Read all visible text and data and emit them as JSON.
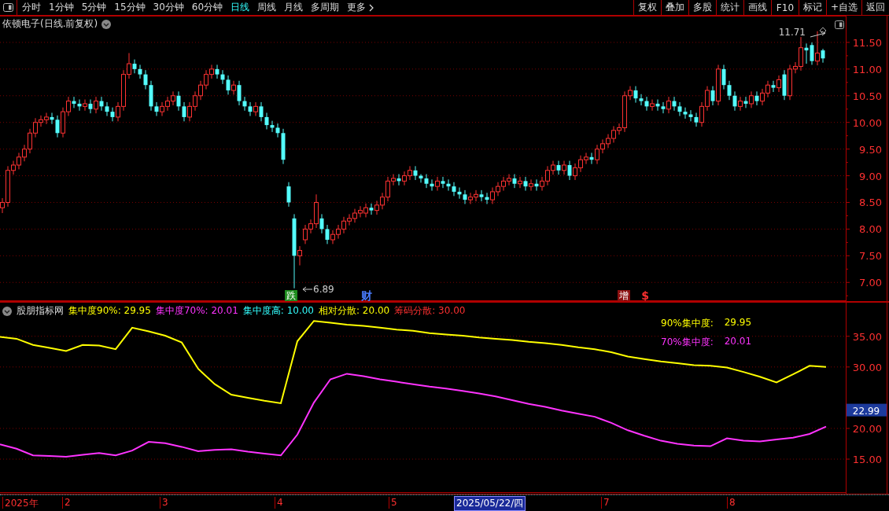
{
  "toolbar": {
    "periods": [
      {
        "label": "分时",
        "selected": false
      },
      {
        "label": "1分钟",
        "selected": false
      },
      {
        "label": "5分钟",
        "selected": false
      },
      {
        "label": "15分钟",
        "selected": false
      },
      {
        "label": "30分钟",
        "selected": false
      },
      {
        "label": "60分钟",
        "selected": false
      },
      {
        "label": "日线",
        "selected": true
      },
      {
        "label": "周线",
        "selected": false
      },
      {
        "label": "月线",
        "selected": false
      },
      {
        "label": "多周期",
        "selected": false
      },
      {
        "label": "更多",
        "selected": false
      }
    ],
    "actions": [
      "复权",
      "叠加",
      "多股",
      "统计",
      "画线",
      "F10",
      "标记",
      "+自选",
      "返回"
    ]
  },
  "price_pane": {
    "title": "依顿电子(日线.前复权)",
    "high_label": "11.71",
    "low_label": "6.89",
    "event_marks": [
      {
        "text": "跌",
        "kind": "boxed",
        "color": "#1e8c1e"
      },
      {
        "text": "财",
        "kind": "plain",
        "color": "#4a7dff"
      },
      {
        "text": "增",
        "kind": "boxed",
        "color": "#8c1010"
      },
      {
        "text": "$",
        "kind": "plain",
        "color": "#ff3030"
      }
    ],
    "chart_data": {
      "type": "candlestick",
      "grid": true,
      "ylim": [
        6.65,
        12.0
      ],
      "categories": [
        null,
        null,
        null,
        null,
        null,
        null,
        null,
        null,
        null,
        null,
        null,
        null,
        null,
        null,
        null,
        null,
        null,
        null,
        null,
        null,
        null,
        null,
        null,
        null,
        null,
        null,
        null,
        null,
        null,
        null,
        null,
        null,
        null,
        null,
        null,
        null,
        null,
        null,
        null,
        null,
        null,
        null,
        null,
        null,
        null,
        null,
        null,
        null,
        null,
        null,
        null,
        null,
        null,
        null,
        null,
        null,
        null,
        null,
        null,
        null,
        null,
        null,
        null,
        null,
        null,
        null,
        null,
        null,
        null,
        null,
        null,
        null,
        null,
        null,
        null,
        null,
        null,
        null,
        null,
        null,
        null,
        null,
        null,
        null,
        null,
        null,
        null,
        null,
        null,
        null,
        null,
        null,
        null,
        null,
        null,
        null,
        null,
        null,
        null,
        null,
        null,
        null,
        null,
        null,
        null,
        null,
        null,
        null,
        null,
        null,
        null,
        null,
        null,
        null,
        null,
        null,
        null,
        null,
        null,
        null,
        null,
        null,
        null,
        null,
        null,
        null,
        null,
        null,
        null,
        null,
        null,
        null,
        null,
        null,
        null,
        null,
        null,
        null,
        null,
        null,
        null,
        null,
        null,
        null,
        null,
        null,
        null,
        null,
        null,
        null
      ],
      "yticks": [
        {
          "value": 11.5,
          "label": "11.50"
        },
        {
          "value": 11,
          "label": "11.00"
        },
        {
          "value": 10.5,
          "label": "10.50"
        },
        {
          "value": 10,
          "label": "10.00"
        },
        {
          "value": 9.5,
          "label": "9.50"
        },
        {
          "value": 9,
          "label": "9.00"
        },
        {
          "value": 8.5,
          "label": "8.50"
        },
        {
          "value": 8,
          "label": "8.00"
        },
        {
          "value": 7.5,
          "label": "7.50"
        },
        {
          "value": 7,
          "label": "7.00"
        }
      ],
      "ohlc": [
        [
          8.4,
          8.58,
          8.3,
          8.5
        ],
        [
          8.5,
          9.18,
          8.42,
          9.1
        ],
        [
          9.1,
          9.28,
          9.02,
          9.2
        ],
        [
          9.2,
          9.43,
          9.12,
          9.35
        ],
        [
          9.35,
          9.58,
          9.27,
          9.5
        ],
        [
          9.5,
          9.88,
          9.42,
          9.8
        ],
        [
          9.8,
          10.08,
          9.72,
          10.0
        ],
        [
          10.0,
          10.13,
          9.92,
          10.05
        ],
        [
          10.05,
          10.18,
          9.97,
          10.1
        ],
        [
          10.1,
          10.18,
          9.97,
          10.05
        ],
        [
          10.05,
          10.13,
          9.72,
          9.8
        ],
        [
          9.8,
          10.28,
          9.72,
          10.2
        ],
        [
          10.2,
          10.48,
          10.12,
          10.4
        ],
        [
          10.4,
          10.48,
          10.27,
          10.35
        ],
        [
          10.35,
          10.43,
          10.22,
          10.3
        ],
        [
          10.3,
          10.43,
          10.22,
          10.35
        ],
        [
          10.35,
          10.43,
          10.17,
          10.25
        ],
        [
          10.25,
          10.48,
          10.17,
          10.4
        ],
        [
          10.4,
          10.48,
          10.22,
          10.3
        ],
        [
          10.3,
          10.38,
          10.12,
          10.2
        ],
        [
          10.2,
          10.28,
          10.02,
          10.1
        ],
        [
          10.1,
          10.38,
          10.02,
          10.3
        ],
        [
          10.3,
          10.98,
          10.22,
          10.9
        ],
        [
          10.9,
          11.3,
          10.82,
          11.1
        ],
        [
          11.1,
          11.18,
          10.92,
          11.0
        ],
        [
          11.0,
          11.08,
          10.82,
          10.9
        ],
        [
          10.9,
          10.98,
          10.62,
          10.7
        ],
        [
          10.7,
          10.78,
          10.22,
          10.3
        ],
        [
          10.3,
          10.38,
          10.12,
          10.2
        ],
        [
          10.2,
          10.38,
          10.12,
          10.3
        ],
        [
          10.3,
          10.48,
          10.22,
          10.4
        ],
        [
          10.4,
          10.58,
          10.32,
          10.5
        ],
        [
          10.5,
          10.58,
          10.22,
          10.3
        ],
        [
          10.3,
          10.38,
          10.02,
          10.1
        ],
        [
          10.1,
          10.38,
          10.02,
          10.3
        ],
        [
          10.3,
          10.58,
          10.22,
          10.5
        ],
        [
          10.5,
          10.78,
          10.42,
          10.7
        ],
        [
          10.7,
          10.98,
          10.62,
          10.9
        ],
        [
          10.9,
          11.08,
          10.82,
          11.0
        ],
        [
          11.0,
          11.08,
          10.82,
          10.9
        ],
        [
          10.9,
          10.98,
          10.72,
          10.8
        ],
        [
          10.8,
          10.88,
          10.52,
          10.6
        ],
        [
          10.6,
          10.78,
          10.52,
          10.7
        ],
        [
          10.7,
          10.78,
          10.32,
          10.4
        ],
        [
          10.4,
          10.48,
          10.22,
          10.3
        ],
        [
          10.3,
          10.38,
          10.12,
          10.2
        ],
        [
          10.2,
          10.38,
          10.12,
          10.3
        ],
        [
          10.3,
          10.38,
          10.02,
          10.1
        ],
        [
          10.1,
          10.18,
          9.87,
          9.95
        ],
        [
          9.95,
          10.03,
          9.82,
          9.9
        ],
        [
          9.9,
          9.98,
          9.72,
          9.8
        ],
        [
          9.8,
          9.88,
          9.22,
          9.3
        ],
        [
          8.8,
          8.88,
          8.42,
          8.5
        ],
        [
          8.2,
          8.28,
          6.89,
          7.5
        ],
        [
          7.5,
          7.68,
          7.32,
          7.6
        ],
        [
          7.8,
          8.08,
          7.72,
          8.0
        ],
        [
          8.0,
          8.18,
          7.92,
          8.1
        ],
        [
          8.1,
          8.65,
          8.02,
          8.5
        ],
        [
          8.2,
          8.28,
          7.92,
          8.0
        ],
        [
          8.0,
          8.08,
          7.72,
          7.8
        ],
        [
          7.8,
          7.98,
          7.72,
          7.9
        ],
        [
          7.9,
          8.08,
          7.82,
          8.0
        ],
        [
          8.0,
          8.23,
          7.92,
          8.15
        ],
        [
          8.15,
          8.28,
          8.07,
          8.2
        ],
        [
          8.2,
          8.38,
          8.12,
          8.3
        ],
        [
          8.3,
          8.43,
          8.22,
          8.35
        ],
        [
          8.3,
          8.48,
          8.22,
          8.4
        ],
        [
          8.4,
          8.48,
          8.27,
          8.35
        ],
        [
          8.35,
          8.53,
          8.27,
          8.45
        ],
        [
          8.45,
          8.68,
          8.37,
          8.6
        ],
        [
          8.6,
          8.98,
          8.52,
          8.9
        ],
        [
          8.9,
          9.03,
          8.82,
          8.95
        ],
        [
          8.95,
          9.03,
          8.82,
          8.9
        ],
        [
          8.9,
          9.08,
          8.82,
          9.0
        ],
        [
          9.0,
          9.18,
          8.92,
          9.1
        ],
        [
          9.1,
          9.18,
          8.92,
          9.0
        ],
        [
          9.0,
          9.03,
          8.87,
          8.95
        ],
        [
          8.95,
          9.03,
          8.77,
          8.85
        ],
        [
          8.85,
          8.93,
          8.72,
          8.8
        ],
        [
          8.8,
          8.98,
          8.72,
          8.9
        ],
        [
          8.9,
          8.98,
          8.77,
          8.85
        ],
        [
          8.85,
          8.93,
          8.72,
          8.8
        ],
        [
          8.8,
          8.88,
          8.62,
          8.7
        ],
        [
          8.7,
          8.78,
          8.57,
          8.65
        ],
        [
          8.65,
          8.73,
          8.47,
          8.55
        ],
        [
          8.55,
          8.68,
          8.47,
          8.6
        ],
        [
          8.6,
          8.73,
          8.52,
          8.65
        ],
        [
          8.65,
          8.73,
          8.52,
          8.6
        ],
        [
          8.6,
          8.68,
          8.47,
          8.55
        ],
        [
          8.55,
          8.78,
          8.47,
          8.7
        ],
        [
          8.7,
          8.88,
          8.62,
          8.8
        ],
        [
          8.8,
          8.98,
          8.72,
          8.9
        ],
        [
          8.9,
          9.03,
          8.82,
          8.95
        ],
        [
          8.95,
          9.03,
          8.77,
          8.85
        ],
        [
          8.85,
          8.98,
          8.77,
          8.9
        ],
        [
          8.9,
          8.98,
          8.72,
          8.8
        ],
        [
          8.8,
          8.93,
          8.72,
          8.85
        ],
        [
          8.85,
          8.93,
          8.72,
          8.8
        ],
        [
          8.8,
          8.98,
          8.72,
          8.9
        ],
        [
          8.9,
          9.18,
          8.82,
          9.1
        ],
        [
          9.1,
          9.28,
          9.02,
          9.2
        ],
        [
          9.2,
          9.28,
          9.02,
          9.1
        ],
        [
          9.1,
          9.28,
          9.02,
          9.2
        ],
        [
          9.2,
          9.28,
          8.92,
          9.0
        ],
        [
          9.0,
          9.23,
          8.92,
          9.15
        ],
        [
          9.15,
          9.38,
          9.07,
          9.3
        ],
        [
          9.3,
          9.43,
          9.22,
          9.35
        ],
        [
          9.35,
          9.43,
          9.22,
          9.3
        ],
        [
          9.3,
          9.58,
          9.22,
          9.5
        ],
        [
          9.5,
          9.68,
          9.42,
          9.6
        ],
        [
          9.6,
          9.78,
          9.52,
          9.7
        ],
        [
          9.7,
          9.93,
          9.62,
          9.85
        ],
        [
          9.85,
          9.98,
          9.77,
          9.9
        ],
        [
          9.9,
          10.58,
          9.82,
          10.5
        ],
        [
          10.5,
          10.68,
          10.42,
          10.6
        ],
        [
          10.6,
          10.68,
          10.37,
          10.45
        ],
        [
          10.45,
          10.53,
          10.32,
          10.4
        ],
        [
          10.4,
          10.48,
          10.22,
          10.3
        ],
        [
          10.3,
          10.43,
          10.22,
          10.35
        ],
        [
          10.35,
          10.43,
          10.22,
          10.3
        ],
        [
          10.3,
          10.38,
          10.17,
          10.25
        ],
        [
          10.25,
          10.48,
          10.17,
          10.4
        ],
        [
          10.4,
          10.48,
          10.22,
          10.3
        ],
        [
          10.3,
          10.38,
          10.12,
          10.2
        ],
        [
          10.2,
          10.28,
          10.07,
          10.15
        ],
        [
          10.15,
          10.23,
          10.02,
          10.1
        ],
        [
          10.1,
          10.18,
          9.92,
          10.0
        ],
        [
          10.0,
          10.38,
          9.92,
          10.3
        ],
        [
          10.3,
          10.68,
          10.22,
          10.6
        ],
        [
          10.6,
          10.68,
          10.32,
          10.4
        ],
        [
          10.4,
          11.08,
          10.32,
          11.0
        ],
        [
          11.0,
          11.08,
          10.62,
          10.7
        ],
        [
          10.7,
          10.78,
          10.42,
          10.5
        ],
        [
          10.5,
          10.58,
          10.22,
          10.3
        ],
        [
          10.3,
          10.48,
          10.22,
          10.4
        ],
        [
          10.4,
          10.48,
          10.27,
          10.35
        ],
        [
          10.35,
          10.58,
          10.27,
          10.5
        ],
        [
          10.5,
          10.58,
          10.32,
          10.4
        ],
        [
          10.4,
          10.63,
          10.32,
          10.55
        ],
        [
          10.55,
          10.78,
          10.47,
          10.7
        ],
        [
          10.7,
          10.78,
          10.57,
          10.65
        ],
        [
          10.65,
          10.88,
          10.57,
          10.8
        ],
        [
          10.9,
          10.98,
          10.42,
          10.5
        ],
        [
          10.5,
          11.08,
          10.42,
          11.0
        ],
        [
          11.0,
          11.13,
          10.92,
          11.05
        ],
        [
          11.05,
          11.6,
          10.97,
          11.4
        ],
        [
          11.4,
          11.48,
          11.1,
          11.35
        ],
        [
          11.45,
          11.5,
          11.08,
          11.15
        ],
        [
          11.15,
          11.71,
          11.07,
          11.3
        ],
        [
          11.35,
          11.38,
          11.12,
          11.2
        ]
      ]
    }
  },
  "indicator_pane": {
    "name": "股朋指标网",
    "legend": [
      {
        "kind": "series",
        "value": "29.95"
      },
      {
        "kind": "series",
        "value": "20.01"
      },
      {
        "kind": "constant",
        "label": "集中度高:",
        "value": "10.00",
        "color": "#33ffff"
      },
      {
        "kind": "constant",
        "label": "相对分散:",
        "value": "20.00",
        "color": "#ffff00"
      },
      {
        "kind": "constant",
        "label": "筹码分散:",
        "value": "30.00",
        "color": "#ff3030"
      }
    ],
    "inset": [
      {
        "label": "90%集中度:",
        "value": "29.95",
        "color": "#ffff00"
      },
      {
        "label": "70%集中度:",
        "value": "20.01",
        "color": "#ff33ff"
      }
    ],
    "cursor_value": "22.99",
    "chart_data": {
      "type": "line",
      "grid": true,
      "categories": [
        null,
        null,
        null,
        null,
        null,
        null,
        null,
        null,
        null,
        null,
        null,
        null,
        null,
        null,
        null,
        null,
        null,
        null,
        null,
        null,
        null,
        null,
        null,
        null,
        null,
        null,
        null,
        null,
        null,
        null,
        null,
        null,
        null,
        null,
        null,
        null,
        null,
        null,
        null,
        null,
        null,
        null,
        null,
        null,
        null,
        null,
        null,
        null,
        null,
        null,
        null
      ],
      "ylim": [
        9.5,
        40.6
      ],
      "yticks": [
        {
          "value": 15,
          "label": "15.00"
        },
        {
          "value": 20,
          "label": "20.00"
        },
        {
          "value": 30,
          "label": "30.00"
        },
        {
          "value": 35,
          "label": "35.00"
        }
      ],
      "series": [
        {
          "name": "集中度90%:",
          "color": "#ffff00",
          "values": [
            34.9,
            34.6,
            33.6,
            33.1,
            32.6,
            33.6,
            33.5,
            32.9,
            36.4,
            35.8,
            35.1,
            34.0,
            29.7,
            27.2,
            25.5,
            25.0,
            24.5,
            24.1,
            34.2,
            37.5,
            37.2,
            36.9,
            36.7,
            36.4,
            36.1,
            35.9,
            35.5,
            35.3,
            35.1,
            34.8,
            34.6,
            34.4,
            34.1,
            33.9,
            33.6,
            33.2,
            32.9,
            32.4,
            31.7,
            31.3,
            30.9,
            30.6,
            30.3,
            30.2,
            29.9,
            29.2,
            28.4,
            27.5,
            28.8,
            30.2,
            30.0
          ]
        },
        {
          "name": "集中度70%:",
          "color": "#ff33ff",
          "values": [
            17.4,
            16.7,
            15.6,
            15.5,
            15.4,
            15.7,
            16.0,
            15.6,
            16.4,
            17.8,
            17.6,
            17.0,
            16.3,
            16.5,
            16.6,
            16.2,
            15.9,
            15.6,
            19.0,
            24.2,
            28.0,
            28.9,
            28.5,
            28.0,
            27.6,
            27.2,
            26.8,
            26.5,
            26.1,
            25.7,
            25.2,
            24.6,
            24.0,
            23.5,
            22.9,
            22.4,
            21.9,
            20.9,
            19.7,
            18.8,
            18.0,
            17.5,
            17.2,
            17.1,
            18.4,
            18.0,
            17.9,
            18.2,
            18.5,
            19.1,
            20.3
          ]
        }
      ]
    }
  },
  "date_axis": {
    "labels": [
      "2025年",
      "2",
      "3",
      "4",
      "5",
      "7",
      "8"
    ],
    "cursor_date": "2025/05/22/四"
  }
}
